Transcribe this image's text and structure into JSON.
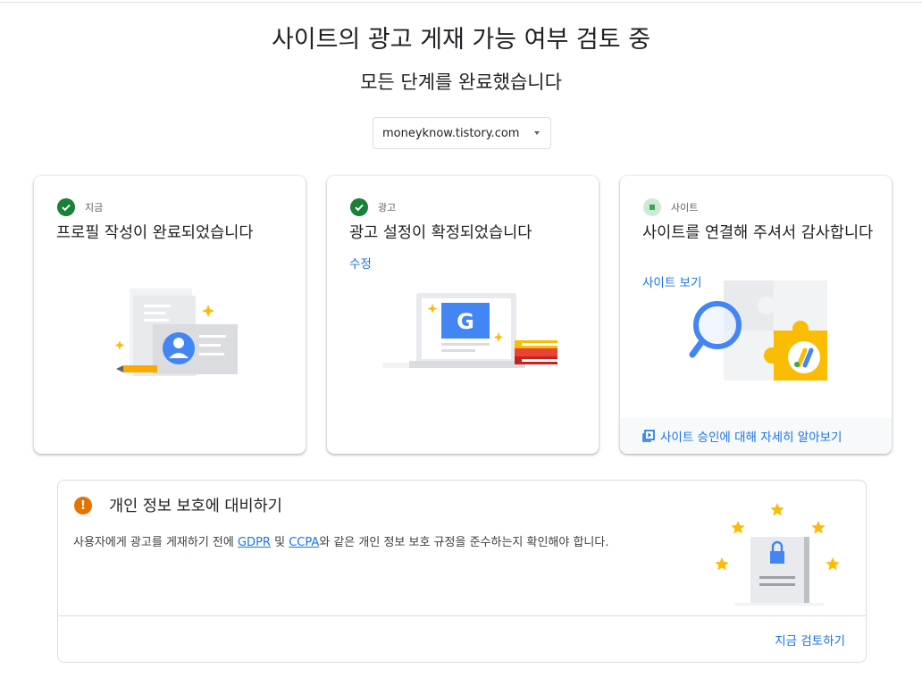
{
  "header": {
    "title": "사이트의 광고 게재 가능 여부 검토 중",
    "subtitle": "모든 단계를 완료했습니다",
    "site_select_value": "moneyknow.tistory.com"
  },
  "cards": [
    {
      "status_label": "지금",
      "title": "프로필 작성이 완료되었습니다",
      "status": "complete"
    },
    {
      "status_label": "광고",
      "title": "광고 설정이 확정되었습니다",
      "link": "수정",
      "status": "complete"
    },
    {
      "status_label": "사이트",
      "title": "사이트를 연결해 주셔서 감사합니다",
      "link": "사이트 보기",
      "footer_link": "사이트 승인에 대해 자세히 알아보기",
      "status": "pending"
    }
  ],
  "privacy": {
    "title": "개인 정보 보호에 대비하기",
    "text_before": "사용자에게 광고를 게재하기 전에 ",
    "link_gdpr": "GDPR",
    "text_and": " 및 ",
    "link_ccpa": "CCPA",
    "text_after": "와 같은 개인 정보 보호 규정을 준수하는지 확인해야 합니다.",
    "review_link": "지금 검토하기"
  },
  "colors": {
    "accent": "#1a73e8",
    "success": "#188038",
    "warning": "#e37400",
    "star": "#fbbc04"
  }
}
